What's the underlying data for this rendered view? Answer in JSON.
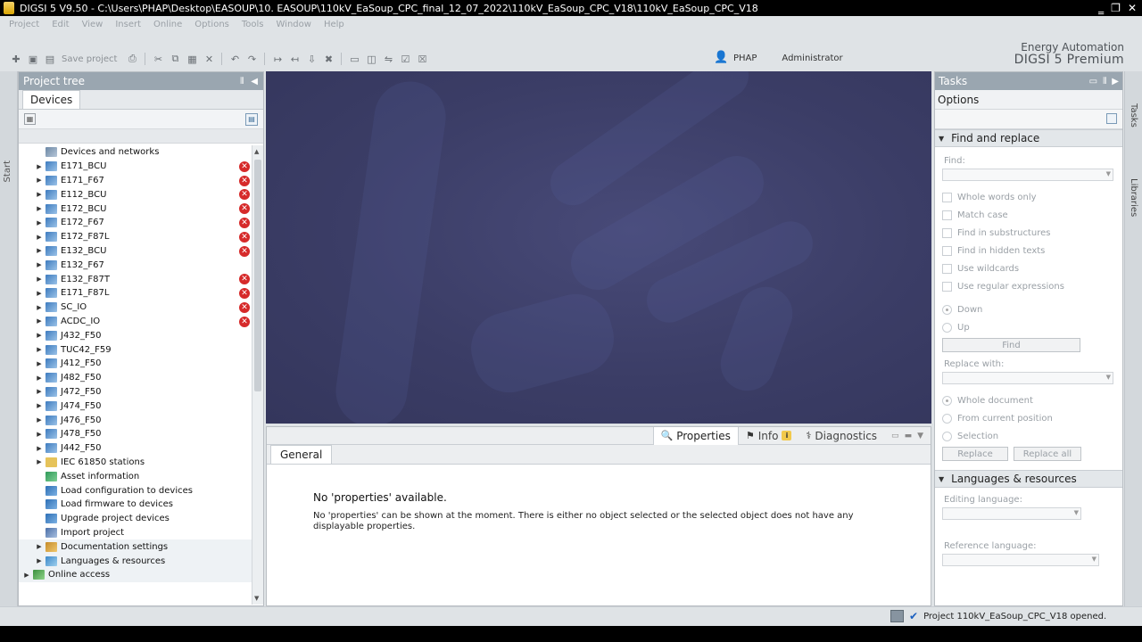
{
  "window": {
    "title": "DIGSI 5 V9.50 - C:\\Users\\PHAP\\Desktop\\EASOUP\\10. EASOUP\\110kV_EaSoup_CPC_final_12_07_2022\\110kV_EaSoup_CPC_V18\\110kV_EaSoup_CPC_V18",
    "minimize": "‗",
    "maximize": "❐",
    "close": "✕"
  },
  "menu": [
    "Project",
    "Edit",
    "View",
    "Insert",
    "Online",
    "Options",
    "Tools",
    "Window",
    "Help"
  ],
  "toolbar": {
    "save_label": "Save project"
  },
  "branding": {
    "line1": "Energy Automation",
    "line2": "DIGSI 5 Premium"
  },
  "user": {
    "name": "PHAP",
    "role": "Administrator"
  },
  "side_tabs": {
    "start": "Start",
    "tasks": "Tasks",
    "libraries": "Libraries"
  },
  "project_tree": {
    "title": "Project tree",
    "tab": "Devices",
    "items": [
      {
        "label": "Devices and networks",
        "icon": "network-icon",
        "arrow": false,
        "error": false
      },
      {
        "label": "E171_BCU",
        "icon": "device-icon",
        "arrow": true,
        "error": true
      },
      {
        "label": "E171_F67",
        "icon": "device-icon",
        "arrow": true,
        "error": true
      },
      {
        "label": "E112_BCU",
        "icon": "device-icon",
        "arrow": true,
        "error": true
      },
      {
        "label": "E172_BCU",
        "icon": "device-icon",
        "arrow": true,
        "error": true
      },
      {
        "label": "E172_F67",
        "icon": "device-icon",
        "arrow": true,
        "error": true
      },
      {
        "label": "E172_F87L",
        "icon": "device-icon",
        "arrow": true,
        "error": true
      },
      {
        "label": "E132_BCU",
        "icon": "device-icon",
        "arrow": true,
        "error": true
      },
      {
        "label": "E132_F67",
        "icon": "device-icon",
        "arrow": true,
        "error": false
      },
      {
        "label": "E132_F87T",
        "icon": "device-icon",
        "arrow": true,
        "error": true
      },
      {
        "label": "E171_F87L",
        "icon": "device-icon",
        "arrow": true,
        "error": true
      },
      {
        "label": "SC_IO",
        "icon": "device-icon",
        "arrow": true,
        "error": true
      },
      {
        "label": "ACDC_IO",
        "icon": "device-icon",
        "arrow": true,
        "error": true
      },
      {
        "label": "J432_F50",
        "icon": "device-icon",
        "arrow": true,
        "error": false
      },
      {
        "label": "TUC42_F59",
        "icon": "device-icon",
        "arrow": true,
        "error": false
      },
      {
        "label": "J412_F50",
        "icon": "device-icon",
        "arrow": true,
        "error": false
      },
      {
        "label": "J482_F50",
        "icon": "device-icon",
        "arrow": true,
        "error": false
      },
      {
        "label": "J472_F50",
        "icon": "device-icon",
        "arrow": true,
        "error": false
      },
      {
        "label": "J474_F50",
        "icon": "device-icon",
        "arrow": true,
        "error": false
      },
      {
        "label": "J476_F50",
        "icon": "device-icon",
        "arrow": true,
        "error": false
      },
      {
        "label": "J478_F50",
        "icon": "device-icon",
        "arrow": true,
        "error": false
      },
      {
        "label": "J442_F50",
        "icon": "device-icon",
        "arrow": true,
        "error": false
      },
      {
        "label": "IEC 61850 stations",
        "icon": "folder-icon",
        "arrow": true,
        "error": false
      },
      {
        "label": "Asset information",
        "icon": "asset-icon",
        "arrow": false,
        "error": false
      },
      {
        "label": "Load configuration to devices",
        "icon": "load-icon",
        "arrow": false,
        "error": false
      },
      {
        "label": "Load firmware to devices",
        "icon": "load-icon",
        "arrow": false,
        "error": false
      },
      {
        "label": "Upgrade project devices",
        "icon": "load-icon",
        "arrow": false,
        "error": false
      },
      {
        "label": "Import project",
        "icon": "import-icon",
        "arrow": false,
        "error": false
      },
      {
        "label": "Documentation settings",
        "icon": "doc-icon",
        "arrow": true,
        "error": false
      },
      {
        "label": "Languages & resources",
        "icon": "lang-icon",
        "arrow": true,
        "error": false
      },
      {
        "label": "Online access",
        "icon": "online-icon",
        "arrow": true,
        "error": false,
        "top": true
      }
    ]
  },
  "inspector": {
    "tabs": [
      "Properties",
      "Info",
      "Diagnostics"
    ],
    "general_tab": "General",
    "heading": "No 'properties' available.",
    "text": "No 'properties' can be shown at the moment. There is either no object selected or the selected object does not have any displayable properties."
  },
  "tasks": {
    "title": "Tasks",
    "options": "Options",
    "find_replace": {
      "title": "Find and replace",
      "find_label": "Find:",
      "checkboxes": [
        "Whole words only",
        "Match case",
        "Find in substructures",
        "Find in hidden texts",
        "Use wildcards",
        "Use regular expressions"
      ],
      "directions": [
        "Down",
        "Up"
      ],
      "find_button": "Find",
      "replace_label": "Replace with:",
      "scopes": [
        "Whole document",
        "From current position",
        "Selection"
      ],
      "replace_button": "Replace",
      "replace_all_button": "Replace all"
    },
    "languages": {
      "title": "Languages & resources",
      "editing_label": "Editing language:",
      "reference_label": "Reference language:"
    }
  },
  "status": {
    "message": "Project 110kV_EaSoup_CPC_V18 opened."
  }
}
